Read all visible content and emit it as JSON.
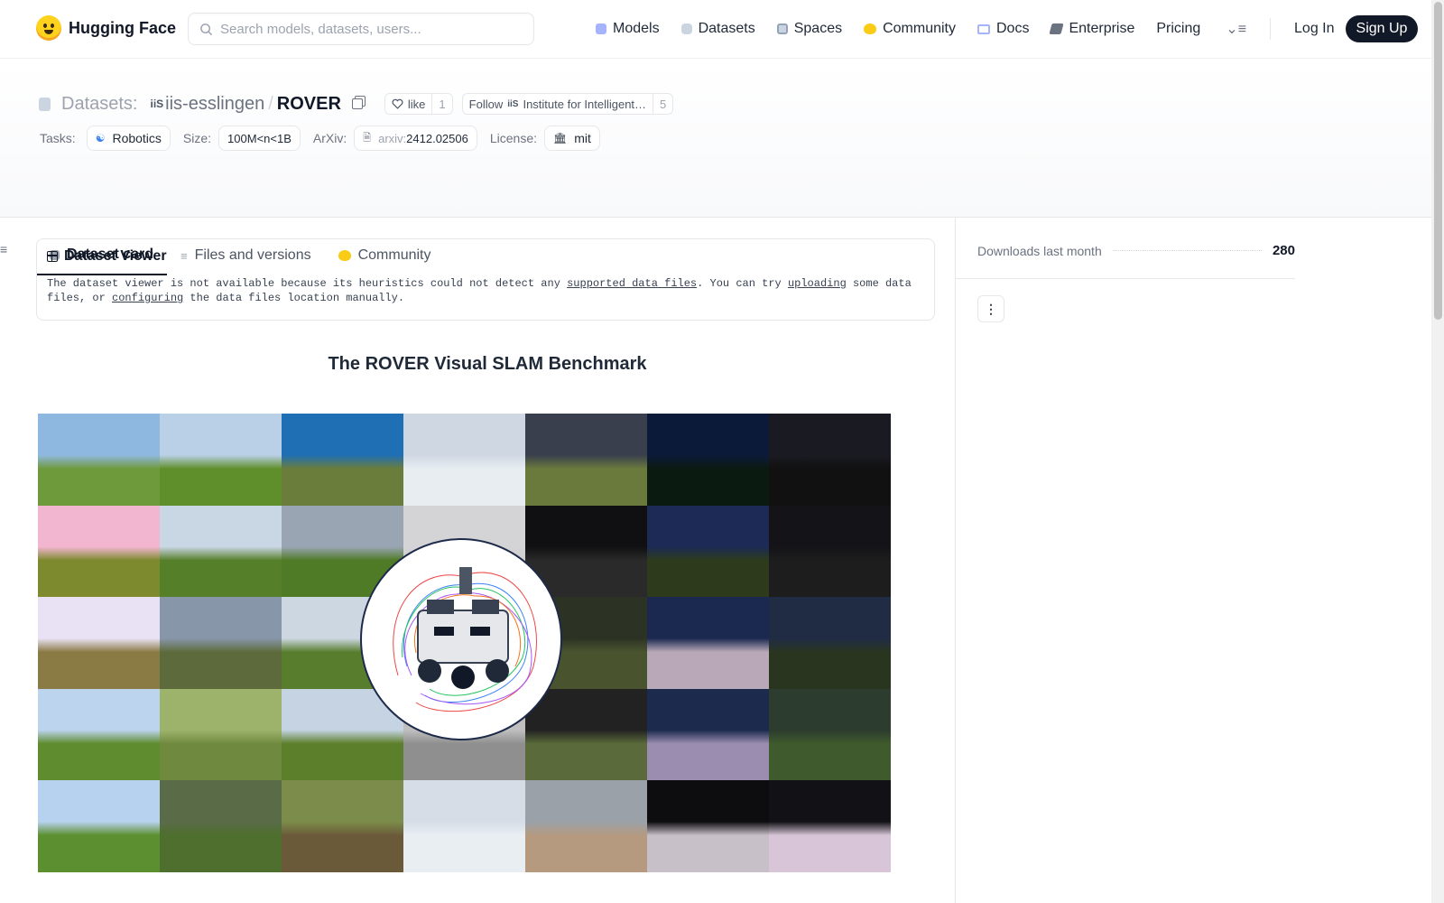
{
  "brand": {
    "name": "Hugging Face"
  },
  "search": {
    "placeholder": "Search models, datasets, users..."
  },
  "nav": {
    "items": [
      {
        "label": "Models",
        "icon": "cube-icon"
      },
      {
        "label": "Datasets",
        "icon": "database-icon"
      },
      {
        "label": "Spaces",
        "icon": "grid-icon"
      },
      {
        "label": "Community",
        "icon": "community-icon"
      },
      {
        "label": "Docs",
        "icon": "book-icon"
      },
      {
        "label": "Enterprise",
        "icon": "enterprise-icon"
      }
    ],
    "pricing": "Pricing",
    "login": "Log In",
    "signup": "Sign Up"
  },
  "repo": {
    "type_label": "Datasets:",
    "org_badge": "iiS",
    "org": "iis-esslingen",
    "slash": "/",
    "name": "ROVER",
    "like_label": "like",
    "like_count": "1",
    "follow_label": "Follow",
    "follow_org": "Institute for Intelligent…",
    "follow_count": "5"
  },
  "meta": {
    "tasks_label": "Tasks:",
    "task": "Robotics",
    "size_label": "Size:",
    "size": "100M<n<1B",
    "arxiv_label": "ArXiv:",
    "arxiv_prefix": "arxiv:",
    "arxiv_id": "2412.02506",
    "license_label": "License:",
    "license": "mit"
  },
  "tabs": [
    "Dataset card",
    "Files and versions",
    "Community"
  ],
  "viewer": {
    "title": "Dataset Viewer",
    "text_1": "The dataset viewer is not available because its heuristics could not detect any ",
    "link_1": "supported data files",
    "text_2": ". You can try ",
    "link_2": "uploading",
    "text_3": " some data files, or ",
    "link_3": "configuring",
    "text_4": " the data files location manually."
  },
  "card": {
    "title": "The ROVER Visual SLAM Benchmark"
  },
  "sidebar": {
    "downloads_label": "Downloads last month",
    "downloads_value": "280"
  },
  "colors": {
    "accent": "#111827",
    "brand": "#ffd21e",
    "muted": "#6b7280"
  }
}
